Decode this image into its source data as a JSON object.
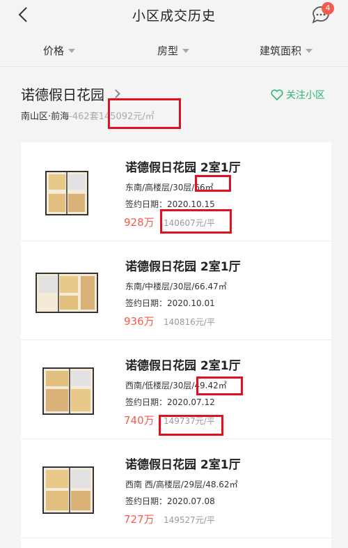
{
  "header": {
    "title": "小区成交历史",
    "badge_count": "4"
  },
  "filters": [
    {
      "label": "价格"
    },
    {
      "label": "房型"
    },
    {
      "label": "建筑面积"
    }
  ],
  "community": {
    "name": "诺德假日花园",
    "district": "南山区·前海",
    "separator": "-",
    "units": "462套",
    "avg_price": "145092元/㎡",
    "follow_label": "关注小区"
  },
  "listings": [
    {
      "title": "诺德假日花园 2室1厅",
      "meta": "东南/高楼层/30层/66㎡",
      "date": "签约日期：2020.10.15",
      "price": "928万",
      "unit_price": "140607元/平"
    },
    {
      "title": "诺德假日花园 2室1厅",
      "meta": "东南/中楼层/30层/66.47㎡",
      "date": "签约日期：2020.10.01",
      "price": "936万",
      "unit_price": "140816元/平"
    },
    {
      "title": "诺德假日花园 2室1厅",
      "meta": "西南/低楼层/30层/49.42㎡",
      "date": "签约日期：2020.07.12",
      "price": "740万",
      "unit_price": "149737元/平"
    },
    {
      "title": "诺德假日花园 2室1厅",
      "meta": "西南 西/高楼层/29层/48.62㎡",
      "date": "签约日期：2020.07.08",
      "price": "727万",
      "unit_price": "149527元/平"
    }
  ],
  "colors": {
    "accent_red": "#f45b4f",
    "accent_green": "#2bb673",
    "highlight_box": "#e0101e"
  }
}
